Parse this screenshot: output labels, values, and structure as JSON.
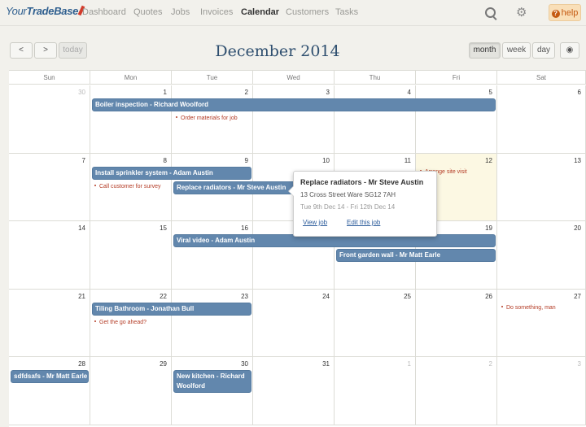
{
  "app": {
    "logo_prefix": "Your",
    "logo_main": "TradeBase",
    "nav": [
      "Dashboard",
      "Quotes",
      "Jobs",
      "Invoices",
      "Calendar",
      "Customers",
      "Tasks"
    ],
    "help_label": "help",
    "help_glyph": "?"
  },
  "toolbar": {
    "prev_icon": "chevron-left-icon",
    "next_icon": "chevron-right-icon",
    "prev": "<",
    "next": ">",
    "today": "today",
    "title": "December 2014",
    "views": [
      "month",
      "week",
      "day"
    ],
    "eye_glyph": "◉"
  },
  "calendar": {
    "weekdays": [
      "Sun",
      "Mon",
      "Tue",
      "Wed",
      "Thu",
      "Fri",
      "Sat"
    ],
    "weeks": [
      [
        {
          "n": "30",
          "other": true
        },
        {
          "n": "1"
        },
        {
          "n": "2"
        },
        {
          "n": "3"
        },
        {
          "n": "4"
        },
        {
          "n": "5"
        },
        {
          "n": "6"
        }
      ],
      [
        {
          "n": "7"
        },
        {
          "n": "8"
        },
        {
          "n": "9"
        },
        {
          "n": "10"
        },
        {
          "n": "11"
        },
        {
          "n": "12",
          "today": true
        },
        {
          "n": "13"
        }
      ],
      [
        {
          "n": "14"
        },
        {
          "n": "15"
        },
        {
          "n": "16"
        },
        {
          "n": "17"
        },
        {
          "n": "18"
        },
        {
          "n": "19"
        },
        {
          "n": "20"
        }
      ],
      [
        {
          "n": "21"
        },
        {
          "n": "22"
        },
        {
          "n": "23"
        },
        {
          "n": "24"
        },
        {
          "n": "25"
        },
        {
          "n": "26"
        },
        {
          "n": "27"
        }
      ],
      [
        {
          "n": "28"
        },
        {
          "n": "29"
        },
        {
          "n": "30"
        },
        {
          "n": "31"
        },
        {
          "n": "1",
          "other": true
        },
        {
          "n": "2",
          "other": true
        },
        {
          "n": "3",
          "other": true
        }
      ]
    ],
    "events": [
      {
        "label": "Boiler inspection - Richard Woolford",
        "week": 0,
        "start": 1,
        "end": 5,
        "slot": 0
      },
      {
        "label": "Install sprinkler system - Adam Austin",
        "week": 1,
        "start": 1,
        "end": 2,
        "slot": 0
      },
      {
        "label": "Replace radiators - Mr Steve Austin",
        "week": 1,
        "start": 2,
        "end": 3,
        "slot": 1
      },
      {
        "label": "Viral video - Adam Austin",
        "week": 2,
        "start": 2,
        "end": 5,
        "slot": 0
      },
      {
        "label": "Front garden wall - Mr Matt Earle",
        "week": 2,
        "start": 4,
        "end": 5,
        "slot": 1
      },
      {
        "label": "Tiling Bathroom - Jonathan Bull",
        "week": 3,
        "start": 1,
        "end": 2,
        "slot": 0
      },
      {
        "label": "sdfdsafs - Mr Matt Earle",
        "week": 4,
        "start": 0,
        "end": 0,
        "slot": 0
      },
      {
        "label": "New kitchen - Richard Woolford",
        "week": 4,
        "start": 2,
        "end": 2,
        "slot": 0,
        "tall": true
      }
    ],
    "tasks": [
      {
        "label": "Order materials for job",
        "week": 0,
        "day": 2,
        "slot": 1
      },
      {
        "label": "Call customer for survey",
        "week": 1,
        "day": 1,
        "slot": 1
      },
      {
        "label": "Arrange site visit",
        "week": 1,
        "day": 5,
        "slot": 0
      },
      {
        "label": "Do something, man",
        "week": 3,
        "day": 6,
        "slot": 0
      },
      {
        "label": "Get the go ahead?",
        "week": 3,
        "day": 1,
        "slot": 1
      }
    ]
  },
  "popover": {
    "title": "Replace radiators - Mr Steve Austin",
    "address": "13 Cross Street Ware SG12 7AH",
    "dates": "Tue 9th Dec 14 - Fri 12th Dec 14",
    "view_link": "View job",
    "edit_link": "Edit this job"
  }
}
